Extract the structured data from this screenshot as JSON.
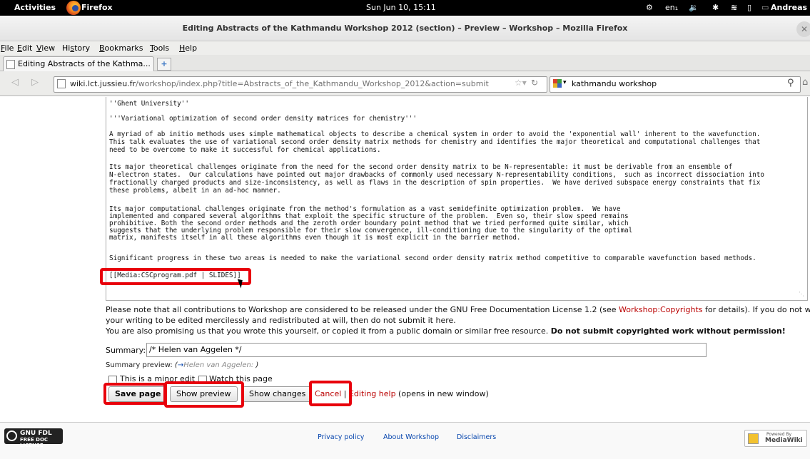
{
  "topbar": {
    "activities": "Activities",
    "app": "Firefox",
    "clock": "Sun Jun 10, 15:11",
    "keyboard": "en₁",
    "user": "Andreas Savin"
  },
  "window": {
    "title": "Editing Abstracts of the Kathmandu Workshop 2012 (section) – Preview – Workshop – Mozilla Firefox"
  },
  "menu": {
    "items": [
      {
        "pre": "",
        "u": "F",
        "post": "ile"
      },
      {
        "pre": "",
        "u": "E",
        "post": "dit"
      },
      {
        "pre": "",
        "u": "V",
        "post": "iew"
      },
      {
        "pre": "Hi",
        "u": "s",
        "post": "tory"
      },
      {
        "pre": "",
        "u": "B",
        "post": "ookmarks"
      },
      {
        "pre": "",
        "u": "T",
        "post": "ools"
      },
      {
        "pre": "",
        "u": "H",
        "post": "elp"
      }
    ]
  },
  "tabs": [
    {
      "label": "Editing Abstracts of the Kathma..."
    }
  ],
  "nav": {
    "url_host": "wiki.lct.jussieu.fr",
    "url_path": "/workshop/index.php?title=Abstracts_of_the_Kathmandu_Workshop_2012&action=submit",
    "search_value": "kathmandu workshop"
  },
  "editor": {
    "lines": [
      "''Ghent University''",
      "",
      "'''Variational optimization of second order density matrices for chemistry'''",
      "",
      "A myriad of ab initio methods uses simple mathematical objects to describe a chemical system in order to avoid the 'exponential wall' inherent to the wavefunction.",
      "This talk evaluates the use of variational second order density matrix methods for chemistry and identifies the major theoretical and computational challenges that",
      "need to be overcome to make it successful for chemical applications.",
      "",
      "Its major theoretical challenges originate from the need for the second order density matrix to be N-representable: it must be derivable from an ensemble of",
      "N-electron states.  Our calculations have pointed out major drawbacks of commonly used necessary N-representability conditions,  such as incorrect dissociation into",
      "fractionally charged products and size-inconsistency, as well as flaws in the description of spin properties.  We have derived subspace energy constraints that fix",
      "these problems, albeit in an ad-hoc manner.",
      "",
      "Its major computational challenges originate from the method's formulation as a vast semidefinite optimization problem.  We have",
      "implemented and compared several algorithms that exploit the specific structure of the problem.  Even so, their slow speed remains",
      "prohibitive. Both the second order methods and the zeroth order boundary point method that we tried performed quite similar, which",
      "suggests that the underlying problem responsible for their slow convergence, ill-conditioning due to the singularity of the optimal",
      "matrix, manifests itself in all these algorithms even though it is most explicit in the barrier method.",
      "",
      "Significant progress in these two areas is needed to make the variational second order density matrix method competitive to comparable wavefunction based methods.",
      "",
      "[[Media:CSCprogram.pdf | SLIDES]]"
    ]
  },
  "notice": {
    "line1_pre": "Please note that all contributions to Workshop are considered to be released under the GNU Free Documentation License 1.2 (see ",
    "line1_link": "Workshop:Copyrights",
    "line1_post": " for details). If you do not want",
    "line2": "your writing to be edited mercilessly and redistributed at will, then do not submit it here.",
    "line3_pre": "You are also promising us that you wrote this yourself, or copied it from a public domain or similar free resource. ",
    "line3_bold": "Do not submit copyrighted work without permission!"
  },
  "summary": {
    "label": "Summary:",
    "value": "/* Helen van Aggelen */",
    "preview_label": "Summary preview:",
    "preview_arrow": "→",
    "preview_link": "Helen van Aggelen:",
    "preview_close": " )",
    "preview_open": " ("
  },
  "options": {
    "minor_edit": "This is a minor edit",
    "watch": "Watch this page"
  },
  "buttons": {
    "save": "Save page",
    "preview": "Show preview",
    "changes": "Show changes",
    "cancel": "Cancel",
    "separator": " | ",
    "help_link": "Editing help",
    "help_note": " (opens in new window)"
  },
  "footer": {
    "privacy": "Privacy policy",
    "about": "About Workshop",
    "disclaimers": "Disclaimers",
    "gnu_title": "GNU FDL",
    "gnu_sub": "FREE DOC LICENSE",
    "mw_powered": "Powered By",
    "mw_name": "MediaWiki"
  },
  "colors": {
    "annotation_red": "#e8000b",
    "link_red": "#ba0000",
    "link_blue": "#0645ad"
  }
}
